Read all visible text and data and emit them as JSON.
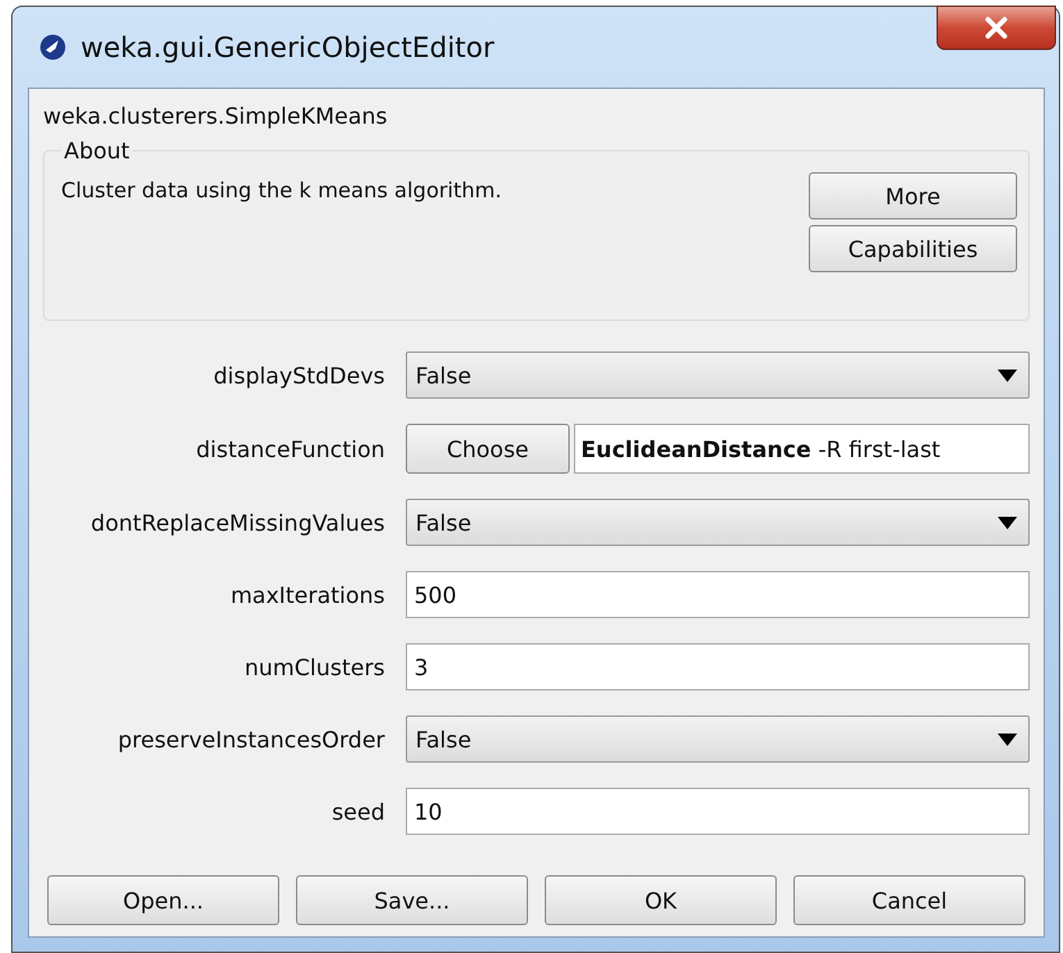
{
  "window": {
    "title": "weka.gui.GenericObjectEditor"
  },
  "class_name": "weka.clusterers.SimpleKMeans",
  "about": {
    "title": "About",
    "text": "Cluster data using the k means algorithm.",
    "buttons": [
      "More",
      "Capabilities"
    ]
  },
  "properties": [
    {
      "label": "displayStdDevs",
      "kind": "dropdown",
      "value": "False"
    },
    {
      "label": "distanceFunction",
      "kind": "chooser",
      "button": "Choose",
      "value": "**EuclideanDistance** -R first-last"
    },
    {
      "label": "dontReplaceMissingValues",
      "kind": "dropdown",
      "value": "False"
    },
    {
      "label": "maxIterations",
      "kind": "text",
      "value": "500"
    },
    {
      "label": "numClusters",
      "kind": "text",
      "value": "3"
    },
    {
      "label": "preserveInstancesOrder",
      "kind": "dropdown",
      "value": "False"
    },
    {
      "label": "seed",
      "kind": "text",
      "value": "10"
    }
  ],
  "buttons": [
    "Open...",
    "Save...",
    "OK",
    "Cancel"
  ]
}
